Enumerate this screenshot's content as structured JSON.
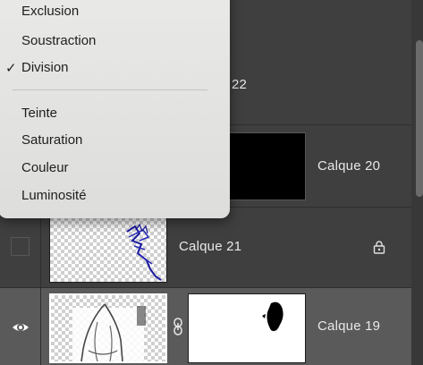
{
  "blend_menu": {
    "items": [
      {
        "label": "Exclusion",
        "checked": false
      },
      {
        "label": "Soustraction",
        "checked": false
      },
      {
        "label": "Division",
        "checked": true
      },
      {
        "label": "Teinte",
        "checked": false
      },
      {
        "label": "Saturation",
        "checked": false
      },
      {
        "label": "Couleur",
        "checked": false
      },
      {
        "label": "Luminosité",
        "checked": false
      }
    ],
    "check_glyph": "✓"
  },
  "layers": [
    {
      "name": "22",
      "visible": false
    },
    {
      "name": "Calque 20",
      "visible": false,
      "has_mask": true
    },
    {
      "name": "Calque 21",
      "visible": false,
      "locked": true
    },
    {
      "name": "Calque 19",
      "visible": true,
      "selected": true,
      "has_mask": true,
      "linked": true
    }
  ],
  "icons": {
    "visibility": "eye-icon",
    "lock": "lock-icon",
    "link": "link-chain-icon"
  },
  "colors": {
    "panel_bg": "#3f3f3f",
    "selected_row": "#5a5a5a",
    "menu_bg": "#e6e6e4",
    "text": "#e8e8e8"
  }
}
